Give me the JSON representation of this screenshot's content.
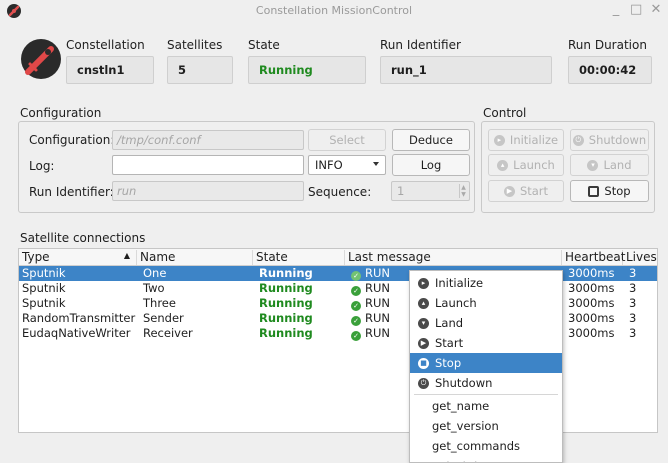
{
  "window": {
    "title": "Constellation MissionControl",
    "min": "_",
    "max": "□",
    "close": "✕"
  },
  "header": {
    "constellation": {
      "label": "Constellation",
      "value": "cnstln1"
    },
    "satellites": {
      "label": "Satellites",
      "value": "5"
    },
    "state": {
      "label": "State",
      "value": "Running",
      "color": "#1f8a1f"
    },
    "run_identifier": {
      "label": "Run Identifier",
      "value": "run_1"
    },
    "run_duration": {
      "label": "Run Duration",
      "value": "00:00:42"
    }
  },
  "configuration": {
    "title": "Configuration",
    "config_label": "Configuration:",
    "config_value": "/tmp/conf.conf",
    "select_label": "Select",
    "deduce_label": "Deduce",
    "log_label": "Log:",
    "log_value": "",
    "log_level": "INFO",
    "log_button": "Log",
    "run_id_label": "Run Identifier:",
    "run_id_value": "run",
    "sequence_label": "Sequence:",
    "sequence_value": "1"
  },
  "control": {
    "title": "Control",
    "initialize": "Initialize",
    "shutdown": "Shutdown",
    "launch": "Launch",
    "land": "Land",
    "start": "Start",
    "stop": "Stop"
  },
  "satellites": {
    "title": "Satellite connections",
    "columns": [
      "Type",
      "Name",
      "State",
      "Last message",
      "Heartbeat",
      "Lives"
    ],
    "rows": [
      {
        "type": "Sputnik",
        "name": "One",
        "state": "Running",
        "last_message": "RUN",
        "heartbeat": "3000ms",
        "lives": "3"
      },
      {
        "type": "Sputnik",
        "name": "Two",
        "state": "Running",
        "last_message": "RUN",
        "heartbeat": "3000ms",
        "lives": "3"
      },
      {
        "type": "Sputnik",
        "name": "Three",
        "state": "Running",
        "last_message": "RUN",
        "heartbeat": "3000ms",
        "lives": "3"
      },
      {
        "type": "RandomTransmitter",
        "name": "Sender",
        "state": "Running",
        "last_message": "RUN",
        "heartbeat": "3000ms",
        "lives": "3"
      },
      {
        "type": "EudaqNativeWriter",
        "name": "Receiver",
        "state": "Running",
        "last_message": "RUN",
        "heartbeat": "3000ms",
        "lives": "3"
      }
    ],
    "selected_row": 0
  },
  "context_menu": {
    "items": [
      "Initialize",
      "Launch",
      "Land",
      "Start",
      "Stop",
      "Shutdown"
    ],
    "commands": [
      "get_name",
      "get_version",
      "get_commands",
      "get_status"
    ],
    "selected": "Stop",
    "highlight_color": "#3d84c7"
  }
}
